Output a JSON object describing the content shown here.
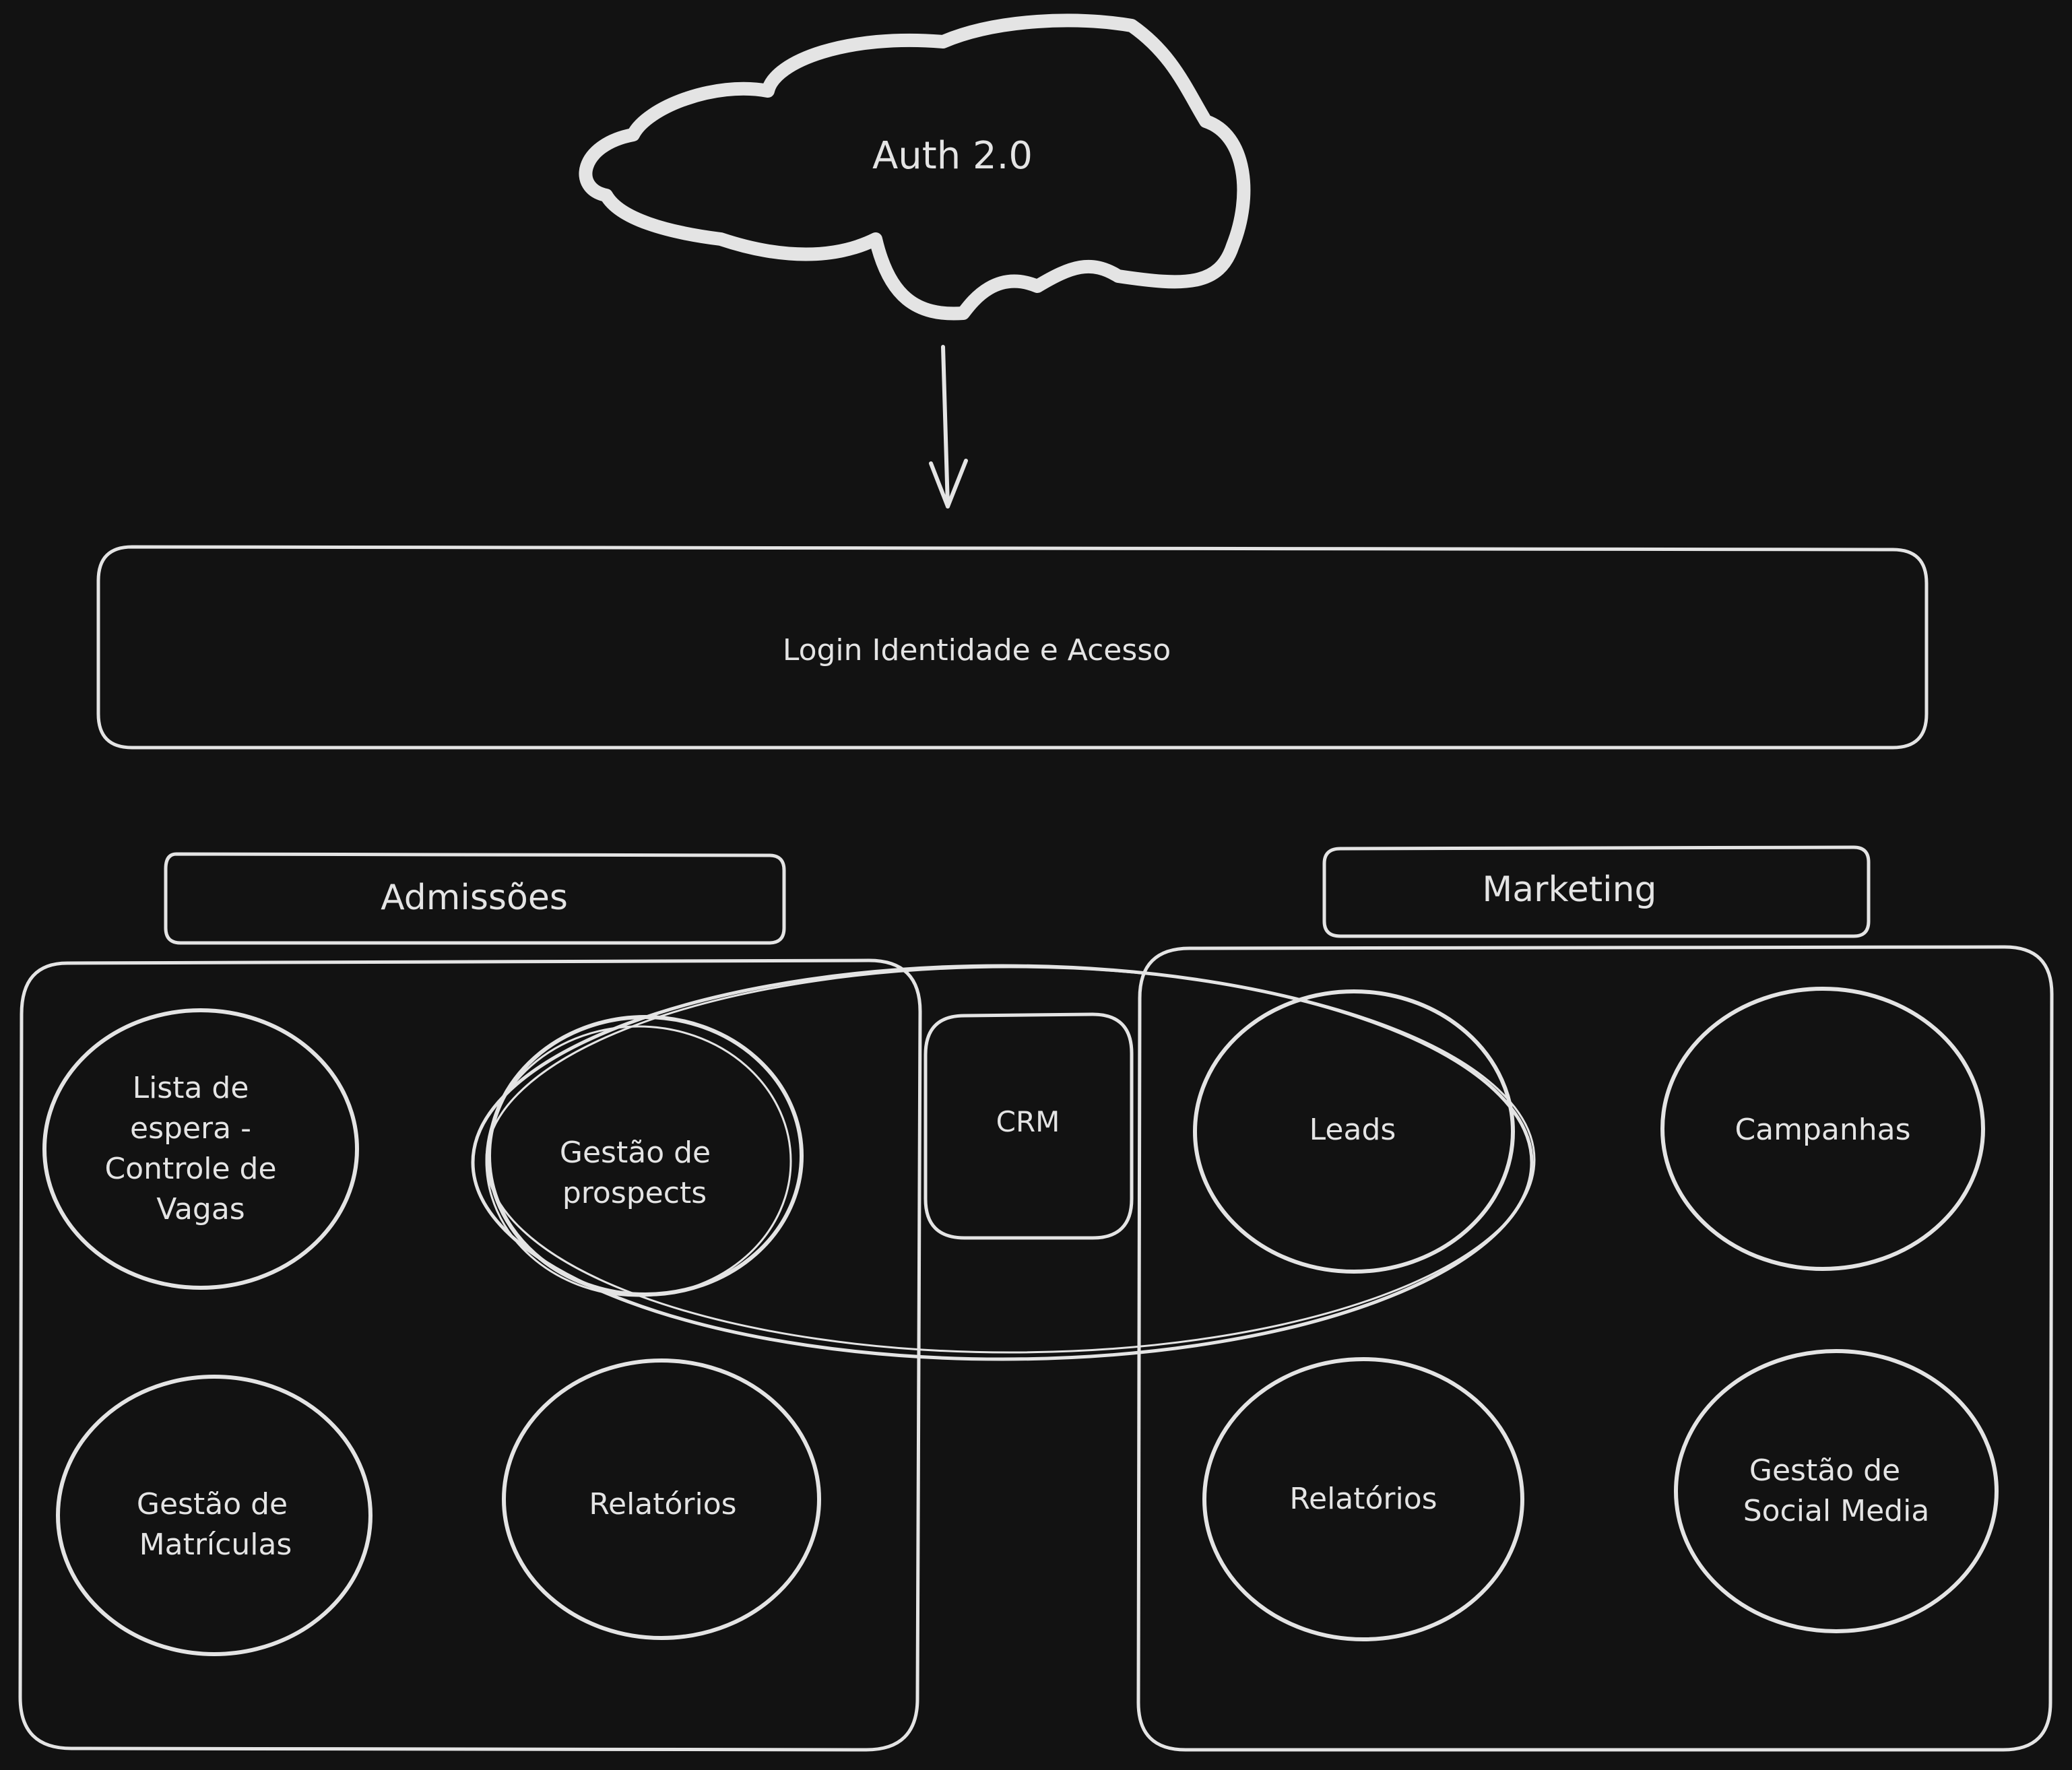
{
  "diagram": {
    "auth": {
      "label": "Auth 2.0",
      "shape": "cloud"
    },
    "login": {
      "label": "Login Identidade e Acesso"
    },
    "admissoes": {
      "title": "Admissões",
      "nodes": [
        [
          "Lista de",
          "espera -",
          "Controle de",
          "Vagas"
        ],
        [
          "Gestão de",
          "prospects"
        ],
        [
          "Gestão de",
          "Matrículas"
        ],
        [
          "Relatórios"
        ]
      ]
    },
    "crm": {
      "label": "CRM"
    },
    "marketing": {
      "title": "Marketing",
      "nodes": [
        [
          "Leads"
        ],
        [
          "Campanhas"
        ],
        [
          "Relatórios"
        ],
        [
          "Gestão de",
          "Social Media"
        ]
      ]
    }
  },
  "colors": {
    "background": "#121212",
    "stroke": "#e4e4e4"
  }
}
